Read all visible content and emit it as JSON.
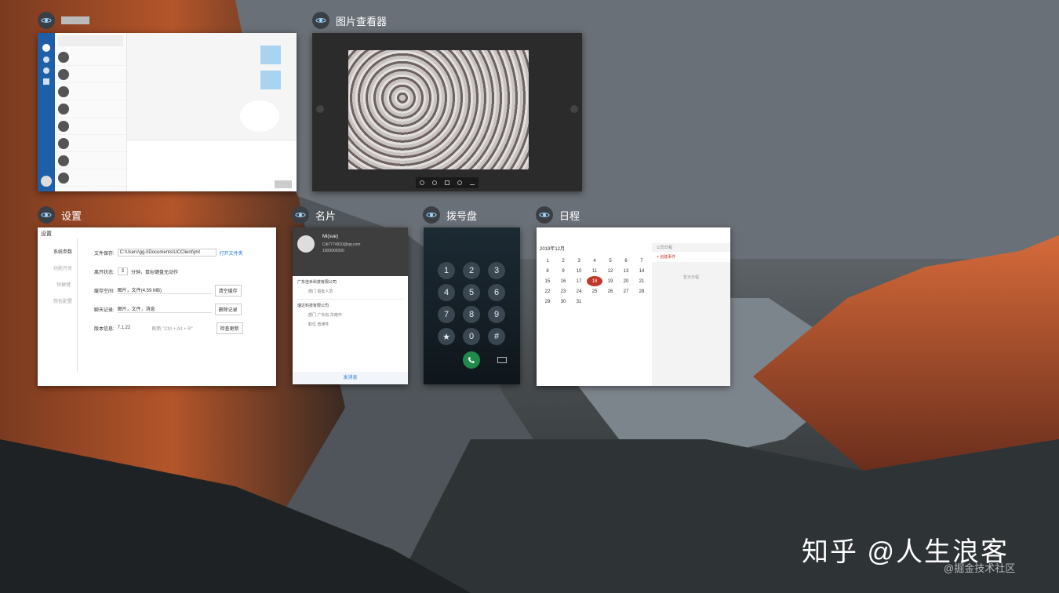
{
  "windows": {
    "chat": {
      "label": ""
    },
    "viewer": {
      "label": "图片查看器"
    },
    "settings": {
      "label": "设置",
      "title": "设置",
      "nav": [
        "系统参数",
        "功能开关",
        "快捷键",
        "颜色配置"
      ],
      "rows": [
        {
          "k": "文件保存:",
          "v": "C:\\Users\\gg-l\\Documents\\UCClient\\jmt",
          "btn": "打开文件夹"
        },
        {
          "k": "离开状态:",
          "v": "3",
          "extra": "分钟，鼠标键盘无动作"
        },
        {
          "k": "缓存空间:",
          "v": "图片，文件(4.59 MB)",
          "btn": "清空缓存"
        },
        {
          "k": "聊天记录:",
          "v": "图片，文件，消息",
          "btn": "删除记录"
        },
        {
          "k": "版本信息:",
          "v": "7.1.22",
          "extra": "刷新  \"Ctrl + Alt + R\"",
          "btn": "检查更新"
        }
      ]
    },
    "card": {
      "label": "名片",
      "name": "Mi(sue)",
      "email": "Cdi7774910@qq.com",
      "phone": "1000000000",
      "company1": "广东佳禾科技有限公司",
      "dept1_k": "部门",
      "dept1_v": "首批人员",
      "company2": "瑞达科技有限公司",
      "dept2_k": "部门",
      "dept2_v": "广东省,华南中",
      "pos_k": "职位",
      "pos_v": "普通件",
      "send": "发消息"
    },
    "dialer": {
      "label": "拨号盘",
      "keys": [
        "1",
        "2",
        "3",
        "4",
        "5",
        "6",
        "7",
        "8",
        "9",
        "★",
        "0",
        "#"
      ]
    },
    "calendar": {
      "label": "日程",
      "month": "2019年12月",
      "week": [
        "日",
        "一",
        "二",
        "三",
        "四",
        "五",
        "六"
      ],
      "days": [
        [
          "1",
          "2",
          "3",
          "4",
          "5",
          "6",
          "7"
        ],
        [
          "8",
          "9",
          "10",
          "11",
          "12",
          "13",
          "14"
        ],
        [
          "15",
          "16",
          "17",
          "18",
          "19",
          "20",
          "21"
        ],
        [
          "22",
          "23",
          "24",
          "25",
          "26",
          "27",
          "28"
        ],
        [
          "29",
          "30",
          "31",
          "",
          "",
          "",
          ""
        ]
      ],
      "today": "18",
      "side_title": "公司日程",
      "side_new": "+ 创建事件",
      "side_empty": "暂无日程"
    }
  },
  "watermark": {
    "main": "知乎 @人生浪客",
    "sub": "@掘金技术社区"
  }
}
